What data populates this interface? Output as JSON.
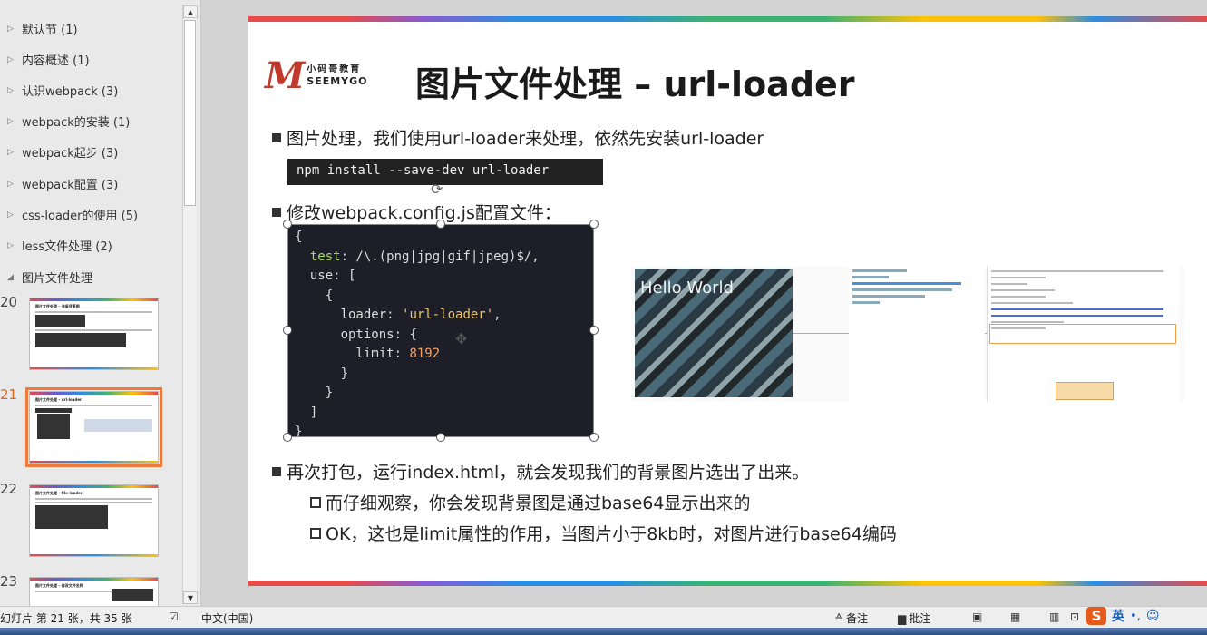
{
  "sidebar": {
    "sections": [
      {
        "label": "默认节 (1)"
      },
      {
        "label": "内容概述 (1)"
      },
      {
        "label": "认识webpack (3)"
      },
      {
        "label": "webpack的安装 (1)"
      },
      {
        "label": "webpack起步 (3)"
      },
      {
        "label": "webpack配置 (3)"
      },
      {
        "label": "css-loader的使用 (5)"
      },
      {
        "label": "less文件处理 (2)"
      },
      {
        "label": "图片文件处理"
      }
    ],
    "thumbnails": [
      {
        "num": "20",
        "title": "图片文件处理 – 准备背景图"
      },
      {
        "num": "21",
        "title": "图片文件处理 – url-loader"
      },
      {
        "num": "22",
        "title": "图片文件处理 – file-loader"
      },
      {
        "num": "23",
        "title": "图片文件处理 – 修改文件名称"
      }
    ]
  },
  "slide": {
    "logo_cn": "小码哥教育",
    "logo_en": "SEEMYGO",
    "title": "图片文件处理 – url-loader",
    "bullet1": "图片处理，我们使用url-loader来处理，依然先安装url-loader",
    "cmd": "npm install --save-dev url-loader",
    "bullet2": "修改webpack.config.js配置文件：",
    "code": {
      "l1": "{",
      "l2_key": "test",
      "l2_val": ": /\\.(png|jpg|gif|jpeg)$/,",
      "l3_key": "use",
      "l3_val": ": [",
      "l4": "{",
      "l5_key": "loader",
      "l5_str": "'url-loader'",
      "l6_key": "options",
      "l6_val": ": {",
      "l7_key": "limit",
      "l7_num": "8192",
      "l8": "}",
      "l9": "}",
      "l10": "]",
      "l11": "}"
    },
    "image_text": "Hello World",
    "bullet3": "再次打包，运行index.html，就会发现我们的背景图片选出了出来。",
    "sub1": "而仔细观察，你会发现背景图是通过base64显示出来的",
    "sub2": "OK，这也是limit属性的作用，当图片小于8kb时，对图片进行base64编码"
  },
  "status": {
    "slide_info": "幻灯片 第 21 张，共 35 张",
    "language": "中文(中国)",
    "notes": "备注",
    "comments": "批注",
    "ime": "英"
  }
}
